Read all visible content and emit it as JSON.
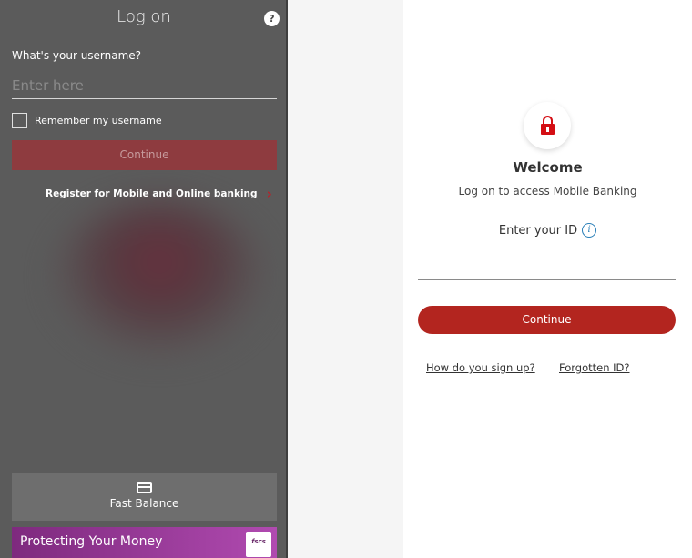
{
  "left_panel": {
    "title": "Log on",
    "help_icon": "?",
    "username_label": "What's your username?",
    "username_placeholder": "Enter here",
    "username_value": "",
    "remember_label": "Remember my username",
    "continue_label": "Continue",
    "register_label": "Register for Mobile and Online banking",
    "register_arrow": "›",
    "fast_balance_label": "Fast Balance",
    "protect_label": "Protecting Your Money",
    "fscs_logo": "fscs"
  },
  "right_panel": {
    "welcome": "Welcome",
    "subtitle": "Log on to access Mobile Banking",
    "id_label": "Enter your ID",
    "info_icon": "i",
    "id_value": "",
    "continue_label": "Continue",
    "signup_link": "How do you sign up?",
    "forgot_link": "Forgotten ID?"
  },
  "colors": {
    "left_bg": "#5b5b5b",
    "left_continue": "#8e3b3f",
    "accent_red": "#b3251f",
    "lock_red": "#d40e14",
    "protect_purple": "#7e2a7e",
    "info_blue": "#2a7fb8"
  },
  "icons": {
    "help": "help-icon",
    "lock": "lock-icon",
    "info": "info-icon",
    "card": "card-icon",
    "chevron": "chevron-right-icon"
  }
}
